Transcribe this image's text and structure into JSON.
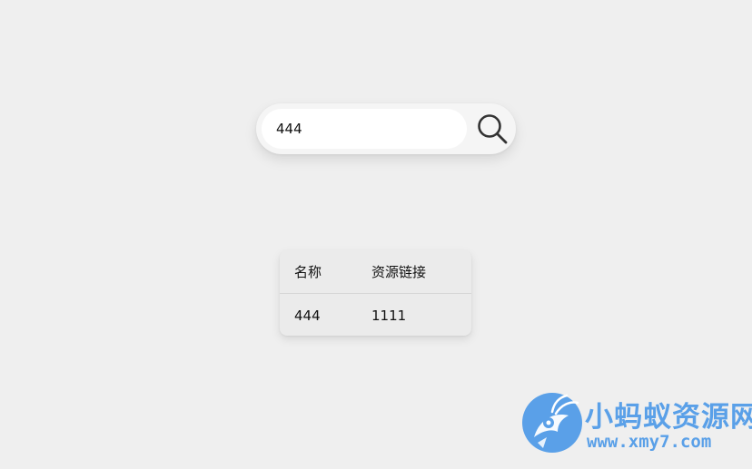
{
  "search": {
    "value": "444",
    "button_icon": "search-icon"
  },
  "table": {
    "headers": [
      "名称",
      "资源链接"
    ],
    "rows": [
      [
        "444",
        "1111"
      ]
    ]
  },
  "watermark": {
    "title": "小蚂蚁资源网",
    "url": "www.xmy7.com",
    "color": "#5aa0e8"
  }
}
